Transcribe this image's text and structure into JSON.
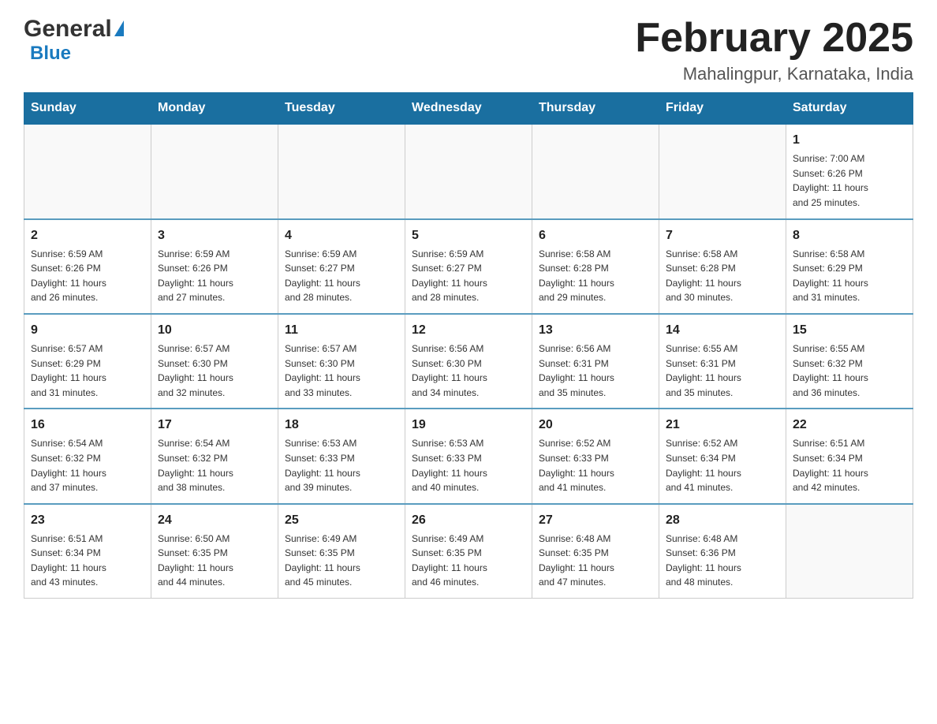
{
  "logo": {
    "general": "General",
    "triangle": "",
    "blue": "Blue"
  },
  "title": "February 2025",
  "location": "Mahalingpur, Karnataka, India",
  "days_of_week": [
    "Sunday",
    "Monday",
    "Tuesday",
    "Wednesday",
    "Thursday",
    "Friday",
    "Saturday"
  ],
  "weeks": [
    [
      {
        "day": "",
        "info": ""
      },
      {
        "day": "",
        "info": ""
      },
      {
        "day": "",
        "info": ""
      },
      {
        "day": "",
        "info": ""
      },
      {
        "day": "",
        "info": ""
      },
      {
        "day": "",
        "info": ""
      },
      {
        "day": "1",
        "info": "Sunrise: 7:00 AM\nSunset: 6:26 PM\nDaylight: 11 hours\nand 25 minutes."
      }
    ],
    [
      {
        "day": "2",
        "info": "Sunrise: 6:59 AM\nSunset: 6:26 PM\nDaylight: 11 hours\nand 26 minutes."
      },
      {
        "day": "3",
        "info": "Sunrise: 6:59 AM\nSunset: 6:26 PM\nDaylight: 11 hours\nand 27 minutes."
      },
      {
        "day": "4",
        "info": "Sunrise: 6:59 AM\nSunset: 6:27 PM\nDaylight: 11 hours\nand 28 minutes."
      },
      {
        "day": "5",
        "info": "Sunrise: 6:59 AM\nSunset: 6:27 PM\nDaylight: 11 hours\nand 28 minutes."
      },
      {
        "day": "6",
        "info": "Sunrise: 6:58 AM\nSunset: 6:28 PM\nDaylight: 11 hours\nand 29 minutes."
      },
      {
        "day": "7",
        "info": "Sunrise: 6:58 AM\nSunset: 6:28 PM\nDaylight: 11 hours\nand 30 minutes."
      },
      {
        "day": "8",
        "info": "Sunrise: 6:58 AM\nSunset: 6:29 PM\nDaylight: 11 hours\nand 31 minutes."
      }
    ],
    [
      {
        "day": "9",
        "info": "Sunrise: 6:57 AM\nSunset: 6:29 PM\nDaylight: 11 hours\nand 31 minutes."
      },
      {
        "day": "10",
        "info": "Sunrise: 6:57 AM\nSunset: 6:30 PM\nDaylight: 11 hours\nand 32 minutes."
      },
      {
        "day": "11",
        "info": "Sunrise: 6:57 AM\nSunset: 6:30 PM\nDaylight: 11 hours\nand 33 minutes."
      },
      {
        "day": "12",
        "info": "Sunrise: 6:56 AM\nSunset: 6:30 PM\nDaylight: 11 hours\nand 34 minutes."
      },
      {
        "day": "13",
        "info": "Sunrise: 6:56 AM\nSunset: 6:31 PM\nDaylight: 11 hours\nand 35 minutes."
      },
      {
        "day": "14",
        "info": "Sunrise: 6:55 AM\nSunset: 6:31 PM\nDaylight: 11 hours\nand 35 minutes."
      },
      {
        "day": "15",
        "info": "Sunrise: 6:55 AM\nSunset: 6:32 PM\nDaylight: 11 hours\nand 36 minutes."
      }
    ],
    [
      {
        "day": "16",
        "info": "Sunrise: 6:54 AM\nSunset: 6:32 PM\nDaylight: 11 hours\nand 37 minutes."
      },
      {
        "day": "17",
        "info": "Sunrise: 6:54 AM\nSunset: 6:32 PM\nDaylight: 11 hours\nand 38 minutes."
      },
      {
        "day": "18",
        "info": "Sunrise: 6:53 AM\nSunset: 6:33 PM\nDaylight: 11 hours\nand 39 minutes."
      },
      {
        "day": "19",
        "info": "Sunrise: 6:53 AM\nSunset: 6:33 PM\nDaylight: 11 hours\nand 40 minutes."
      },
      {
        "day": "20",
        "info": "Sunrise: 6:52 AM\nSunset: 6:33 PM\nDaylight: 11 hours\nand 41 minutes."
      },
      {
        "day": "21",
        "info": "Sunrise: 6:52 AM\nSunset: 6:34 PM\nDaylight: 11 hours\nand 41 minutes."
      },
      {
        "day": "22",
        "info": "Sunrise: 6:51 AM\nSunset: 6:34 PM\nDaylight: 11 hours\nand 42 minutes."
      }
    ],
    [
      {
        "day": "23",
        "info": "Sunrise: 6:51 AM\nSunset: 6:34 PM\nDaylight: 11 hours\nand 43 minutes."
      },
      {
        "day": "24",
        "info": "Sunrise: 6:50 AM\nSunset: 6:35 PM\nDaylight: 11 hours\nand 44 minutes."
      },
      {
        "day": "25",
        "info": "Sunrise: 6:49 AM\nSunset: 6:35 PM\nDaylight: 11 hours\nand 45 minutes."
      },
      {
        "day": "26",
        "info": "Sunrise: 6:49 AM\nSunset: 6:35 PM\nDaylight: 11 hours\nand 46 minutes."
      },
      {
        "day": "27",
        "info": "Sunrise: 6:48 AM\nSunset: 6:35 PM\nDaylight: 11 hours\nand 47 minutes."
      },
      {
        "day": "28",
        "info": "Sunrise: 6:48 AM\nSunset: 6:36 PM\nDaylight: 11 hours\nand 48 minutes."
      },
      {
        "day": "",
        "info": ""
      }
    ]
  ]
}
